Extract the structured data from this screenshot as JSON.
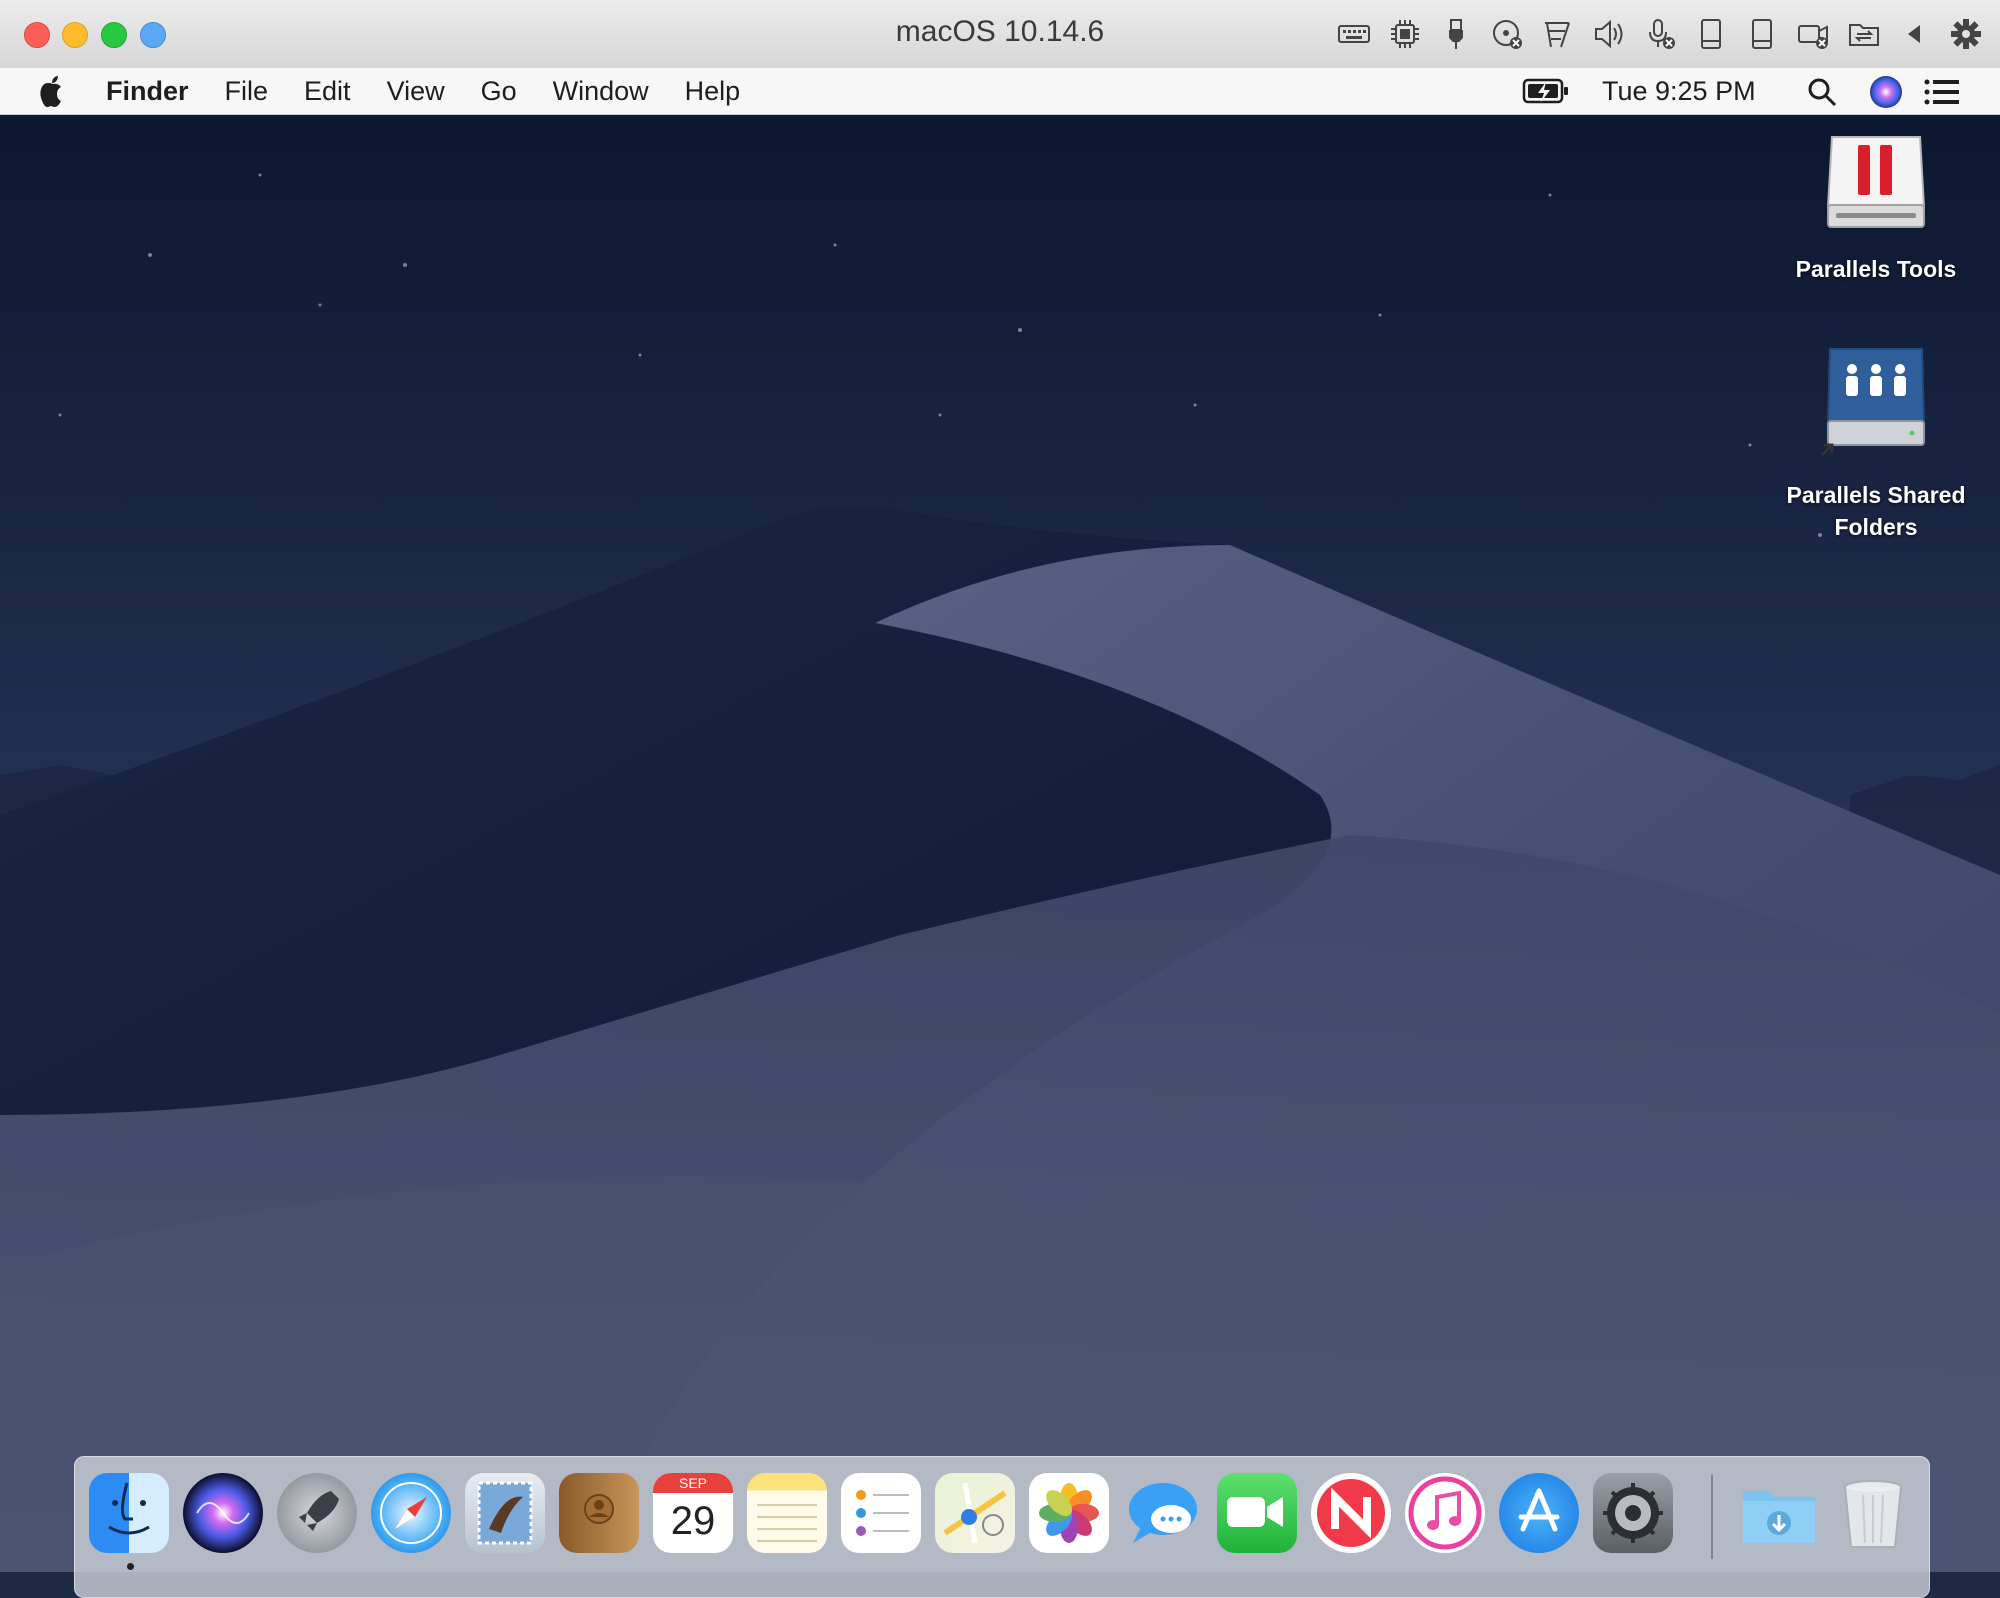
{
  "window": {
    "title": "macOS 10.14.6",
    "toolbar_icons": [
      "keyboard-icon",
      "cpu-icon",
      "usb-icon",
      "cd-disabled-icon",
      "network-disabled-icon",
      "sound-icon",
      "microphone-disabled-icon",
      "hard-disk-icon",
      "hard-disk-2-icon",
      "camera-disabled-icon",
      "shared-folder-icon",
      "back-arrow-icon",
      "gear-icon"
    ]
  },
  "menubar": {
    "app_name": "Finder",
    "items": [
      "File",
      "Edit",
      "View",
      "Go",
      "Window",
      "Help"
    ],
    "clock": "Tue 9:25 PM"
  },
  "desktop": {
    "icons": [
      {
        "label": "Parallels Tools"
      },
      {
        "label": "Parallels Shared Folders"
      }
    ]
  },
  "dock": {
    "apps": [
      "Finder",
      "Siri",
      "Launchpad",
      "Safari",
      "Mail",
      "Contacts",
      "Calendar",
      "Notes",
      "Reminders",
      "Maps",
      "Photos",
      "Messages",
      "FaceTime",
      "News",
      "iTunes",
      "App Store",
      "System Preferences",
      "Downloads",
      "Trash"
    ],
    "calendar_month": "SEP",
    "calendar_day": "29"
  },
  "colors": {
    "close": "#fc5f57",
    "minimize": "#fdbc2e",
    "maximize": "#28c840",
    "wallpaper_sky": "#1a2540",
    "wallpaper_dune": "#4a5576"
  }
}
